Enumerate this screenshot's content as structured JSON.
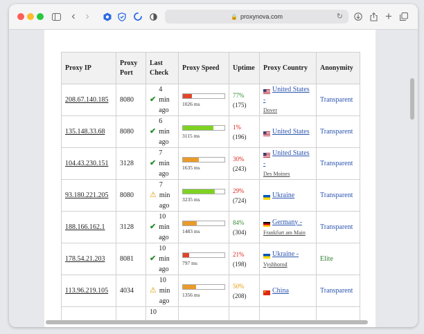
{
  "browser": {
    "url": "proxynova.com"
  },
  "colors": {
    "up_green": "#2e8b2e",
    "up_red": "#d9251d",
    "up_orange": "#e69a00",
    "bar_red": "#e0462b",
    "bar_orange": "#eb9a2a",
    "bar_green": "#7ed321"
  },
  "table": {
    "headers": [
      "Proxy IP",
      "Proxy Port",
      "Last Check",
      "Proxy Speed",
      "Uptime",
      "Proxy Country",
      "Anonymity"
    ],
    "rows": [
      {
        "ip": "208.67.140.185",
        "port": "8080",
        "check_icon": "check-icon",
        "check": "4 min ago",
        "speed_fill": 0.22,
        "speed_color": "#e0462b",
        "speed": "1026 ms",
        "uptime": "77%",
        "uptime_count": "(175)",
        "uptime_color": "#2e8b2e",
        "flag": "us",
        "country": "United States -",
        "city": "Dover",
        "anonymity": "Transparent"
      },
      {
        "ip": "135.148.33.68",
        "port": "8080",
        "check_icon": "check-icon",
        "check": "6 min ago",
        "speed_fill": 0.74,
        "speed_color": "#7ed321",
        "speed": "3115 ms",
        "uptime": "1%",
        "uptime_count": "(196)",
        "uptime_color": "#d9251d",
        "flag": "us",
        "country": "United States",
        "city": "",
        "anonymity": "Transparent"
      },
      {
        "ip": "104.43.230.151",
        "port": "3128",
        "check_icon": "check-icon",
        "check": "7 min ago",
        "speed_fill": 0.38,
        "speed_color": "#eb9a2a",
        "speed": "1635 ms",
        "uptime": "30%",
        "uptime_count": "(243)",
        "uptime_color": "#d9251d",
        "flag": "us",
        "country": "United States -",
        "city": "Des Moines",
        "anonymity": "Transparent"
      },
      {
        "ip": "93.180.221.205",
        "port": "8080",
        "check_icon": "warning-icon",
        "check": "7 min ago",
        "speed_fill": 0.76,
        "speed_color": "#7ed321",
        "speed": "3235 ms",
        "uptime": "29%",
        "uptime_count": "(724)",
        "uptime_color": "#d9251d",
        "flag": "ua",
        "country": "Ukraine",
        "city": "",
        "anonymity": "Transparent"
      },
      {
        "ip": "188.166.162.1",
        "port": "3128",
        "check_icon": "check-icon",
        "check": "10 min ago",
        "speed_fill": 0.34,
        "speed_color": "#eb9a2a",
        "speed": "1483 ms",
        "uptime": "84%",
        "uptime_count": "(304)",
        "uptime_color": "#2e8b2e",
        "flag": "de",
        "country": "Germany -",
        "city": "Frankfurt am Main",
        "anonymity": "Transparent"
      },
      {
        "ip": "178.54.21.203",
        "port": "8081",
        "check_icon": "check-icon",
        "check": "10 min ago",
        "speed_fill": 0.15,
        "speed_color": "#e0462b",
        "speed": "797 ms",
        "uptime": "21%",
        "uptime_count": "(198)",
        "uptime_color": "#d9251d",
        "flag": "ua",
        "country": "Ukraine -",
        "city": "Vyshhorod",
        "anonymity": "Elite"
      },
      {
        "ip": "113.96.219.105",
        "port": "4034",
        "check_icon": "warning-icon",
        "check": "10 min ago",
        "speed_fill": 0.31,
        "speed_color": "#eb9a2a",
        "speed": "1356 ms",
        "uptime": "50%",
        "uptime_count": "(208)",
        "uptime_color": "#e69a00",
        "flag": "cn",
        "country": "China",
        "city": "",
        "anonymity": "Transparent"
      },
      {
        "ip": "",
        "port": "",
        "check_icon": "",
        "check": "10",
        "speed_fill": 0,
        "speed_color": "",
        "speed": "",
        "uptime": "",
        "uptime_count": "",
        "uptime_color": "",
        "flag": "",
        "country": "",
        "city": "",
        "anonymity": ""
      }
    ]
  }
}
